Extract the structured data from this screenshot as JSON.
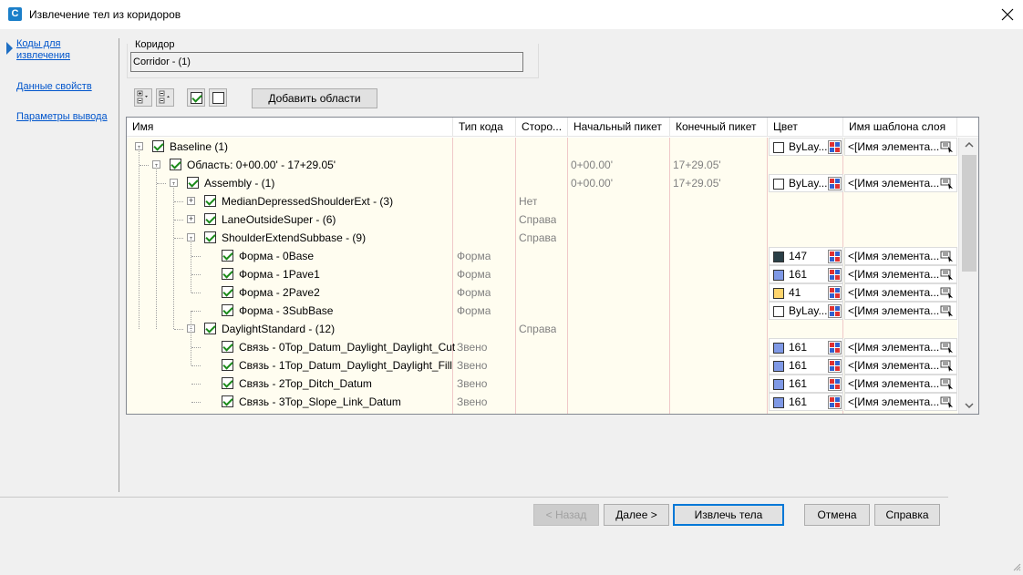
{
  "window": {
    "title": "Извлечение тел из коридоров",
    "app_icon_letter": "C"
  },
  "nav": {
    "items": [
      {
        "label": "Коды для извлечения",
        "active": true
      },
      {
        "label": "Данные свойств"
      },
      {
        "label": "Параметры вывода"
      }
    ]
  },
  "corridor": {
    "group_label": "Коридор",
    "value": "Corridor - (1)"
  },
  "toolbar": {
    "add_regions_label": "Добавить области"
  },
  "grid": {
    "columns": [
      "Имя",
      "Тип кода",
      "Сторо...",
      "Начальный пикет",
      "Конечный пикет",
      "Цвет",
      "Имя шаблона слоя"
    ],
    "rows": [
      {
        "name": "Baseline (1)",
        "code_type": "",
        "side": "",
        "start": "",
        "end": "",
        "color": "ByLay...",
        "swatch": "#ffffff",
        "layer": "<[Имя элемента..."
      },
      {
        "name": "Область: 0+00.00' - 17+29.05'",
        "code_type": "",
        "side": "",
        "start": "0+00.00'",
        "end": "17+29.05'",
        "color": "",
        "swatch": "",
        "layer": ""
      },
      {
        "name": "Assembly - (1)",
        "code_type": "",
        "side": "",
        "start": "0+00.00'",
        "end": "17+29.05'",
        "color": "ByLay...",
        "swatch": "#ffffff",
        "layer": "<[Имя элемента..."
      },
      {
        "name": "MedianDepressedShoulderExt - (3)",
        "code_type": "",
        "side": "Нет",
        "start": "",
        "end": "",
        "color": "",
        "swatch": "",
        "layer": ""
      },
      {
        "name": "LaneOutsideSuper - (6)",
        "code_type": "",
        "side": "Справа",
        "start": "",
        "end": "",
        "color": "",
        "swatch": "",
        "layer": ""
      },
      {
        "name": "ShoulderExtendSubbase - (9)",
        "code_type": "",
        "side": "Справа",
        "start": "",
        "end": "",
        "color": "",
        "swatch": "",
        "layer": ""
      },
      {
        "name": "Форма - 0Base",
        "code_type": "Форма",
        "side": "",
        "start": "",
        "end": "",
        "color": "147",
        "swatch": "#2a3f47",
        "layer": "<[Имя элемента..."
      },
      {
        "name": "Форма - 1Pave1",
        "code_type": "Форма",
        "side": "",
        "start": "",
        "end": "",
        "color": "161",
        "swatch": "#7f99e6",
        "layer": "<[Имя элемента..."
      },
      {
        "name": "Форма - 2Pave2",
        "code_type": "Форма",
        "side": "",
        "start": "",
        "end": "",
        "color": "41",
        "swatch": "#ffd56e",
        "layer": "<[Имя элемента..."
      },
      {
        "name": "Форма - 3SubBase",
        "code_type": "Форма",
        "side": "",
        "start": "",
        "end": "",
        "color": "ByLay...",
        "swatch": "#ffffff",
        "layer": "<[Имя элемента..."
      },
      {
        "name": "DaylightStandard - (12)",
        "code_type": "",
        "side": "Справа",
        "start": "",
        "end": "",
        "color": "",
        "swatch": "",
        "layer": ""
      },
      {
        "name": "Связь - 0Top_Datum_Daylight_Daylight_Cut",
        "code_type": "Звено",
        "side": "",
        "start": "",
        "end": "",
        "color": "161",
        "swatch": "#7f99e6",
        "layer": "<[Имя элемента..."
      },
      {
        "name": "Связь - 1Top_Datum_Daylight_Daylight_Fill",
        "code_type": "Звено",
        "side": "",
        "start": "",
        "end": "",
        "color": "161",
        "swatch": "#7f99e6",
        "layer": "<[Имя элемента..."
      },
      {
        "name": "Связь - 2Top_Ditch_Datum",
        "code_type": "Звено",
        "side": "",
        "start": "",
        "end": "",
        "color": "161",
        "swatch": "#7f99e6",
        "layer": "<[Имя элемента..."
      },
      {
        "name": "Связь - 3Top_Slope_Link_Datum",
        "code_type": "Звено",
        "side": "",
        "start": "",
        "end": "",
        "color": "161",
        "swatch": "#7f99e6",
        "layer": "<[Имя элемента..."
      }
    ]
  },
  "footer": {
    "back": "< Назад",
    "next": "Далее >",
    "extract": "Извлечь тела",
    "cancel": "Отмена",
    "help": "Справка"
  }
}
